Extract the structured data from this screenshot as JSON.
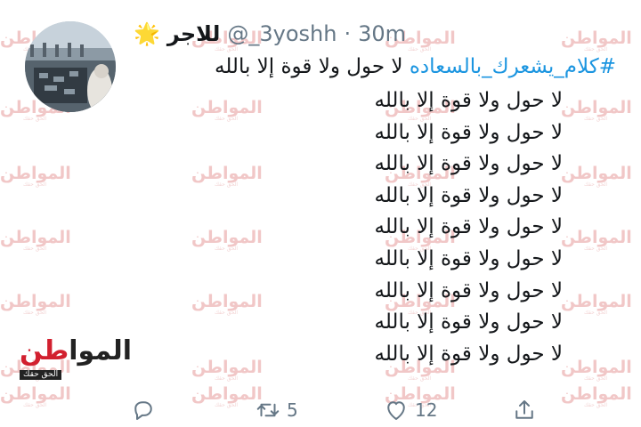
{
  "tweet": {
    "display_name": "للاجر",
    "handle": "@_3yoshh",
    "separator": "·",
    "time": "30m",
    "hashtag": "#كلام_يشعرك_بالسعاده",
    "first_line_text": "لا حول ولا قوة إلا بالله",
    "lines": [
      "لا حول ولا قوة إلا بالله",
      "لا حول ولا قوة إلا بالله",
      "لا حول ولا قوة إلا بالله",
      "لا حول ولا قوة إلا بالله",
      "لا حول ولا قوة إلا بالله",
      "لا حول ولا قوة إلا بالله",
      "لا حول ولا قوة إلا بالله",
      "لا حول ولا قوة إلا بالله",
      "لا حول ولا قوة إلا بالله"
    ]
  },
  "actions": {
    "reply_icon": "reply-icon",
    "retweet_icon": "retweet-icon",
    "retweet_count": "5",
    "like_icon": "heart-icon",
    "like_count": "12",
    "share_icon": "share-icon"
  },
  "watermark": {
    "brand_part1": "الموا",
    "brand_part2": "طن",
    "tagline": "الحق حقك",
    "repeat_text": "المواطن"
  },
  "colors": {
    "hashtag": "#1b95e0",
    "muted": "#657786",
    "brand_red": "#d2202f"
  }
}
